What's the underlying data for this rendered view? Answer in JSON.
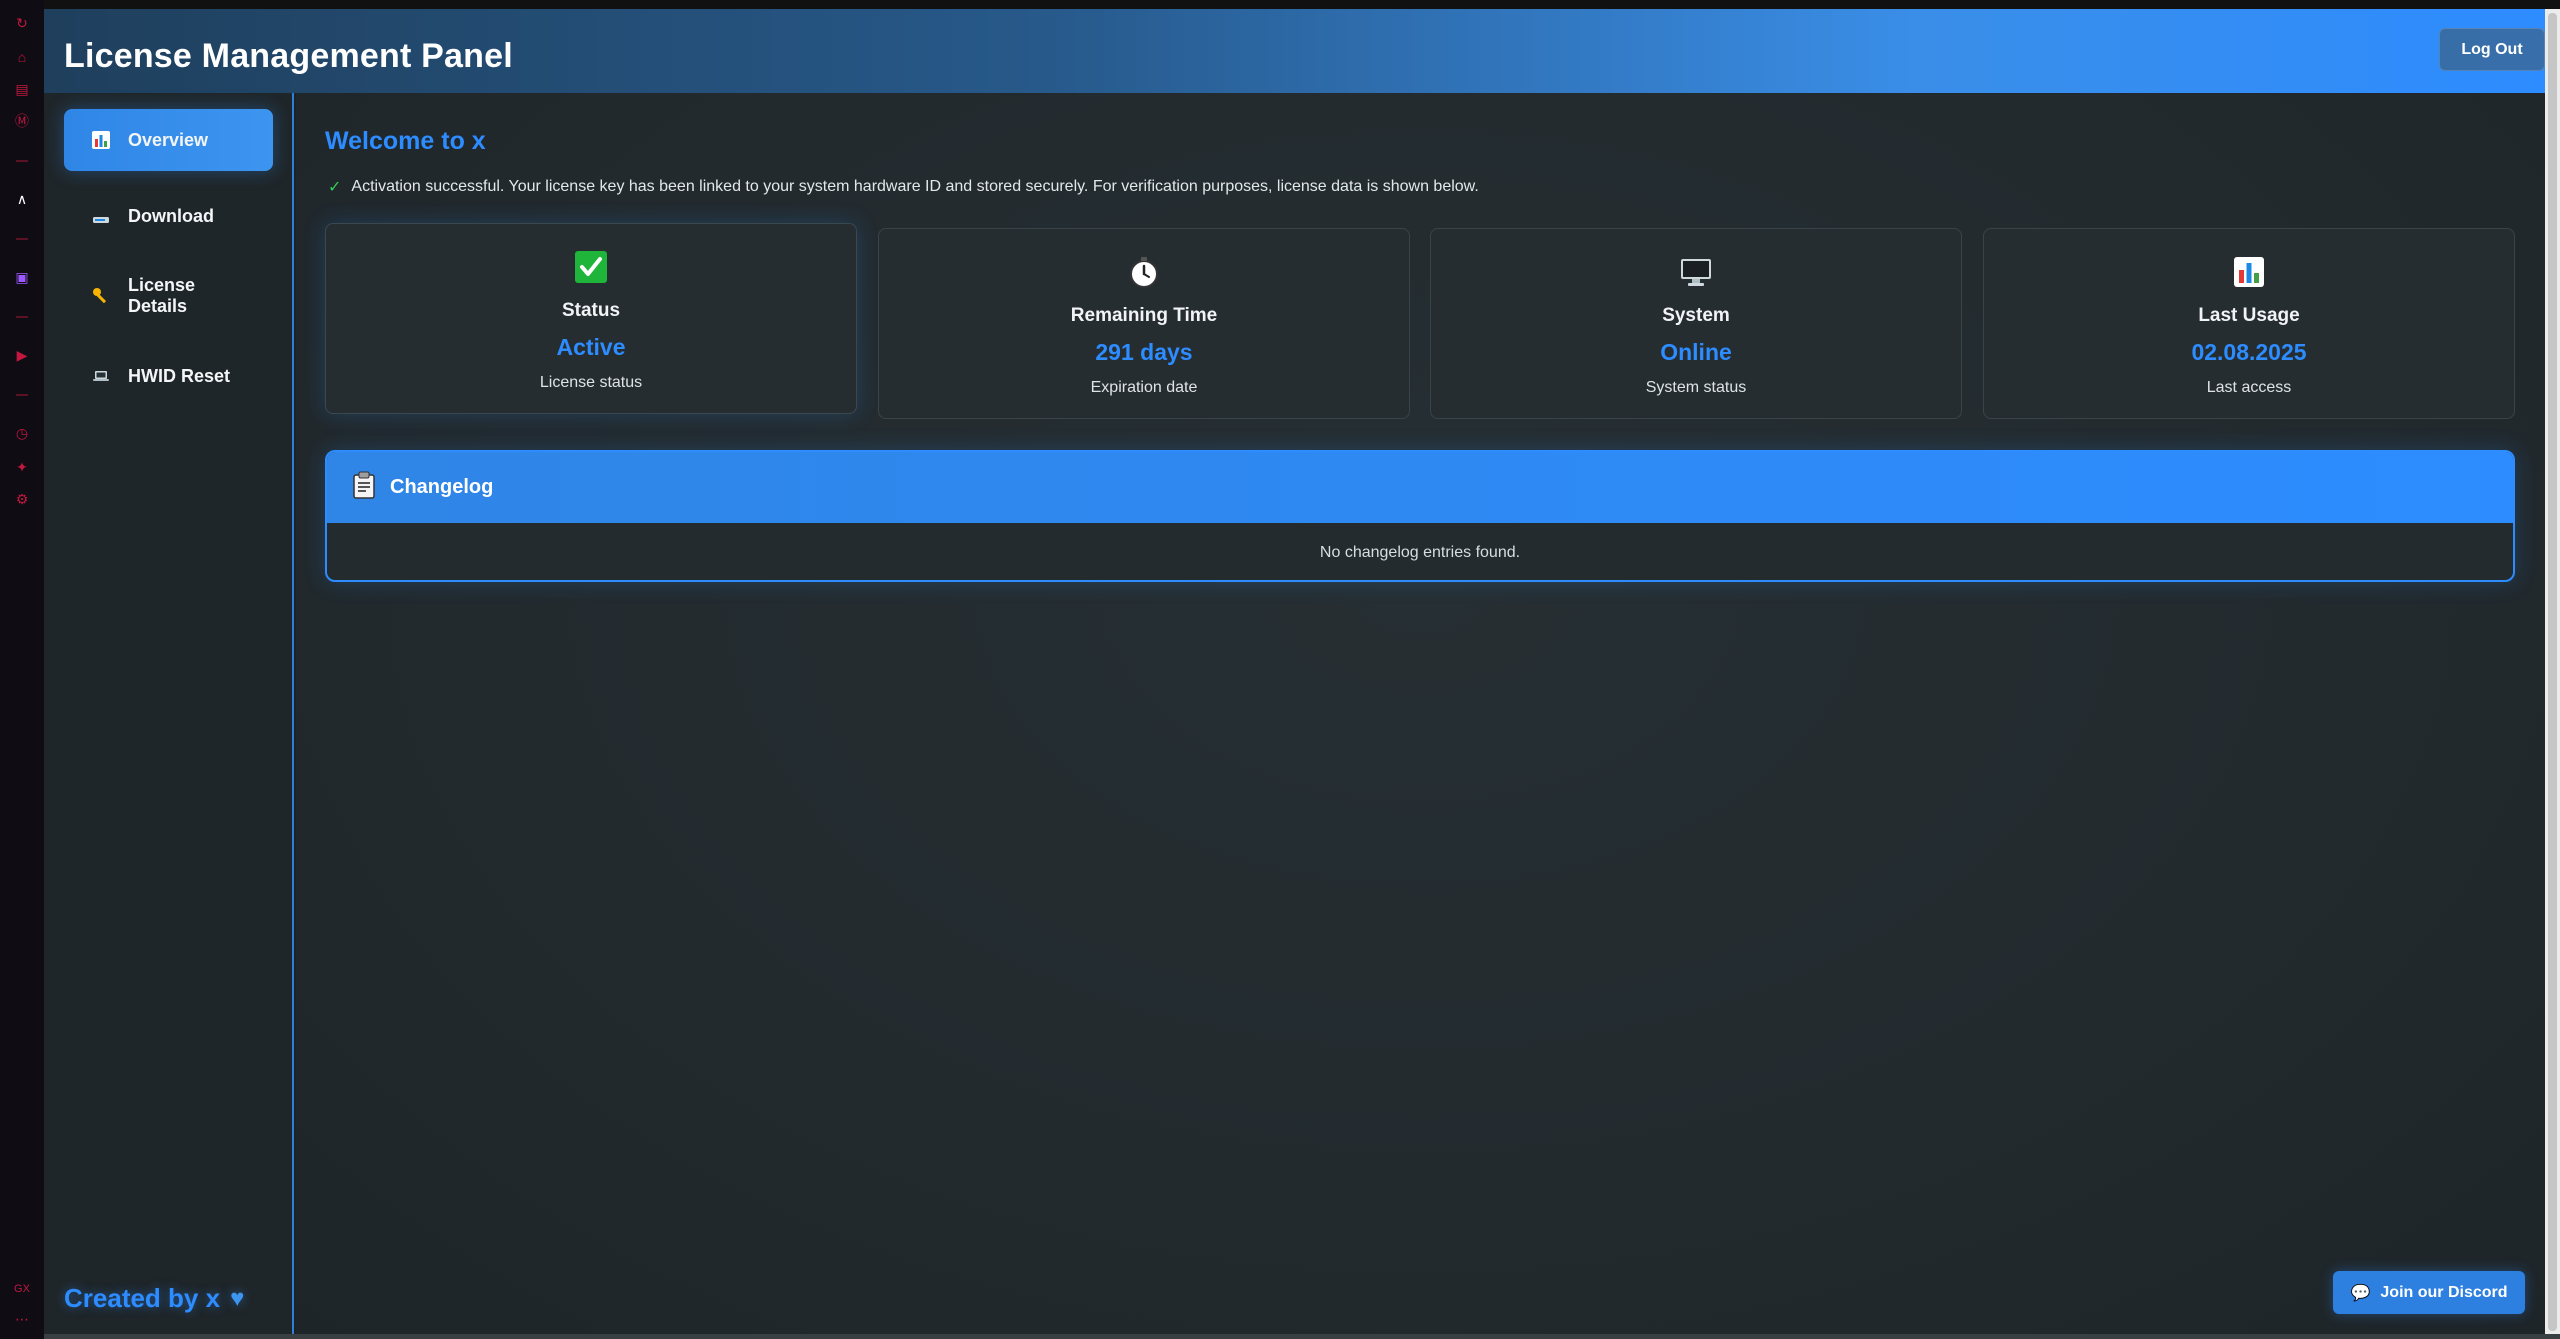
{
  "app": {
    "title": "License Management Panel",
    "logout_label": "Log Out"
  },
  "sidebar": {
    "items": [
      {
        "label": "Overview",
        "icon": "bar-chart-icon",
        "active": true
      },
      {
        "label": "Download",
        "icon": "download-icon",
        "active": false
      },
      {
        "label": "License Details",
        "icon": "key-icon",
        "active": false
      },
      {
        "label": "HWID Reset",
        "icon": "laptop-icon",
        "active": false
      }
    ],
    "footer": "Created by x"
  },
  "main": {
    "welcome": "Welcome to x",
    "activation_message": "Activation successful. Your license key has been linked to your system hardware ID and stored securely. For verification purposes, license data is shown below.",
    "cards": [
      {
        "title": "Status",
        "value": "Active",
        "sub": "License status",
        "icon": "checkbox-icon"
      },
      {
        "title": "Remaining Time",
        "value": "291 days",
        "sub": "Expiration date",
        "icon": "stopwatch-icon"
      },
      {
        "title": "System",
        "value": "Online",
        "sub": "System status",
        "icon": "monitor-icon"
      },
      {
        "title": "Last Usage",
        "value": "02.08.2025",
        "sub": "Last access",
        "icon": "bar-chart-icon"
      }
    ],
    "changelog": {
      "title": "Changelog",
      "empty_text": "No changelog entries found."
    },
    "discord_label": "Join our Discord"
  },
  "colors": {
    "accent": "#2d8cff",
    "background": "#1c2226",
    "card": "#252d31",
    "success": "#33cc55",
    "browser_accent": "#c2183f"
  }
}
